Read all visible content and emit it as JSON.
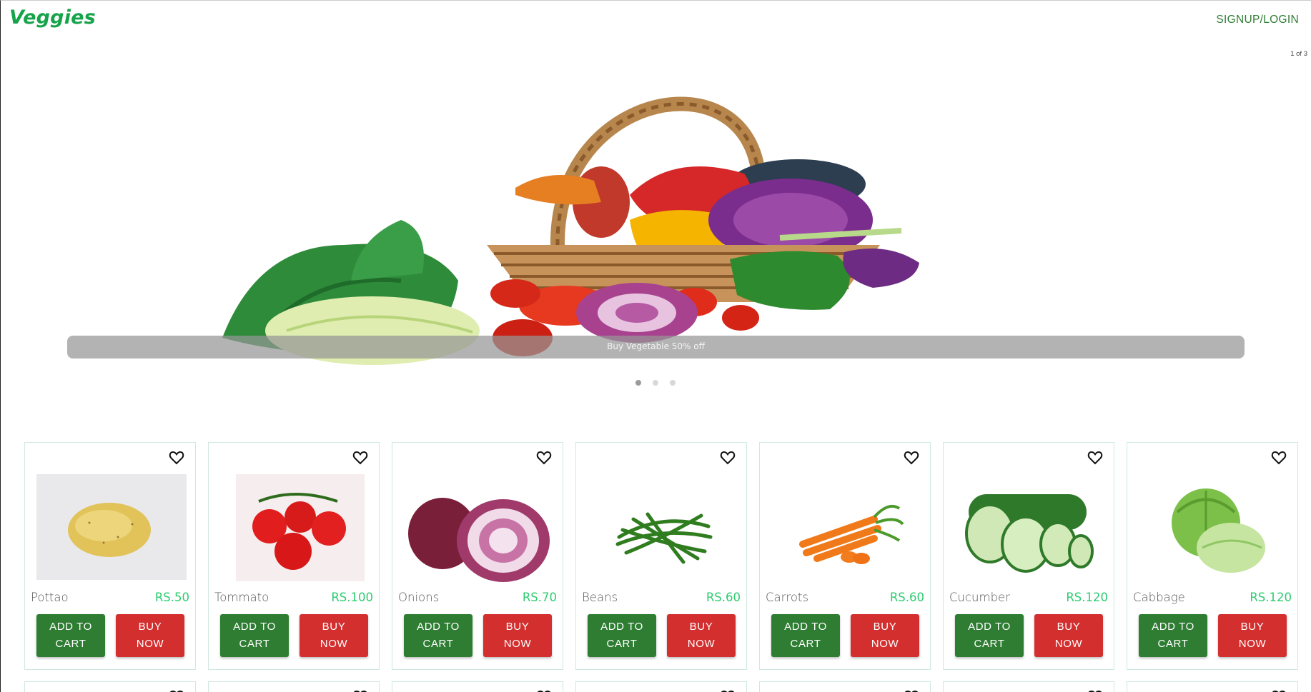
{
  "header": {
    "brand": "Veggies",
    "signup_label": "SIGNUP/LOGIN"
  },
  "carousel": {
    "counter": "1 of 3",
    "caption": "Buy Vegetable 50% off",
    "active_slide": 1,
    "slide_count": 3
  },
  "products": [
    {
      "name": "Pottao",
      "price": "RS.50",
      "add_line1": "ADD TO",
      "add_line2": "CART",
      "buy_line1": "BUY",
      "buy_line2": "NOW",
      "image": "potato"
    },
    {
      "name": "Tommato",
      "price": "RS.100",
      "add_line1": "ADD TO",
      "add_line2": "CART",
      "buy_line1": "BUY",
      "buy_line2": "NOW",
      "image": "tomato"
    },
    {
      "name": "Onions",
      "price": "RS.70",
      "add_line1": "ADD TO",
      "add_line2": "CART",
      "buy_line1": "BUY",
      "buy_line2": "NOW",
      "image": "onion"
    },
    {
      "name": "Beans",
      "price": "RS.60",
      "add_line1": "ADD TO",
      "add_line2": "CART",
      "buy_line1": "BUY",
      "buy_line2": "NOW",
      "image": "beans"
    },
    {
      "name": "Carrots",
      "price": "RS.60",
      "add_line1": "ADD TO",
      "add_line2": "CART",
      "buy_line1": "BUY",
      "buy_line2": "NOW",
      "image": "carrot"
    },
    {
      "name": "Cucumber",
      "price": "RS.120",
      "add_line1": "ADD TO",
      "add_line2": "CART",
      "buy_line1": "BUY",
      "buy_line2": "NOW",
      "image": "cucumber"
    },
    {
      "name": "Cabbage",
      "price": "RS.120",
      "add_line1": "ADD TO",
      "add_line2": "CART",
      "buy_line1": "BUY",
      "buy_line2": "NOW",
      "image": "cabbage"
    }
  ],
  "colors": {
    "brand": "#16a34a",
    "add_to_cart": "#2e7d32",
    "buy_now": "#d32f2f",
    "price": "#2ecc71"
  }
}
